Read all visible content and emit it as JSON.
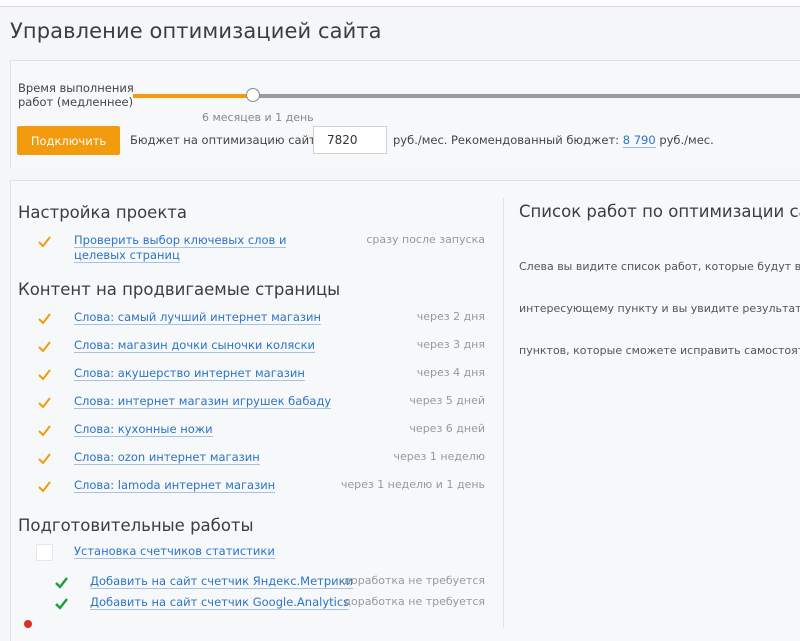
{
  "page": {
    "title": "Управление оптимизацией сайта"
  },
  "colors": {
    "accent": "#f29b0f",
    "link": "#2c74c5",
    "success": "#1a9e3c"
  },
  "slider": {
    "label_line1": "Время выполнения",
    "label_line2": "работ (медленнее)",
    "duration_text": "6 месяцев и 1 день",
    "level_fraction": 0.18
  },
  "controls": {
    "connect_button": "Подключить",
    "budget_label": "Бюджет на оптимизацию сайта:",
    "budget_value": "7820",
    "budget_unit": "руб./мес.",
    "recommended_label": "Рекомендованный бюджет:",
    "recommended_value": "8 790",
    "recommended_unit": "руб./мес."
  },
  "sections": {
    "setup": {
      "title": "Настройка проекта",
      "task": {
        "label_line1": "Проверить выбор ключевых слов и",
        "label_line2": "целевых страниц",
        "time": "сразу после запуска",
        "icon": "check-orange-icon"
      }
    },
    "content": {
      "title": "Контент на продвигаемые страницы",
      "items": [
        {
          "label": "Слова: самый лучший интернет магазин",
          "time": "через 2 дня"
        },
        {
          "label": "Слова: магазин дочки сыночки коляски",
          "time": "через 3 дня"
        },
        {
          "label": "Слова: акушерство интернет магазин",
          "time": "через 4 дня"
        },
        {
          "label": "Слова: интернет магазин игрушек бабаду",
          "time": "через 5 дней"
        },
        {
          "label": "Слова: кухонные ножи",
          "time": "через 6 дней"
        },
        {
          "label": "Слова: ozon интернет магазин",
          "time": "через 1 неделю"
        },
        {
          "label": "Слова: lamoda интернет магазин",
          "time": "через 1 неделю и 1 день"
        }
      ]
    },
    "prep": {
      "title": "Подготовительные работы",
      "group_label": "Установка счетчиков статистики",
      "items": [
        {
          "label": "Добавить на сайт счетчик Яндекс.Метрики",
          "time": "доработка не требуется"
        },
        {
          "label": "Добавить на сайт счетчик Google.Analytics",
          "time": "доработка не требуется"
        }
      ]
    }
  },
  "right_panel": {
    "title": "Список работ по оптимизации сайт",
    "desc_line1": "Слева вы видите список работ, которые будут выпо",
    "desc_line2": "интересующему пункту и вы увидите результаты п",
    "desc_line3": "пунктов, которые сможете исправить самостоятель"
  }
}
